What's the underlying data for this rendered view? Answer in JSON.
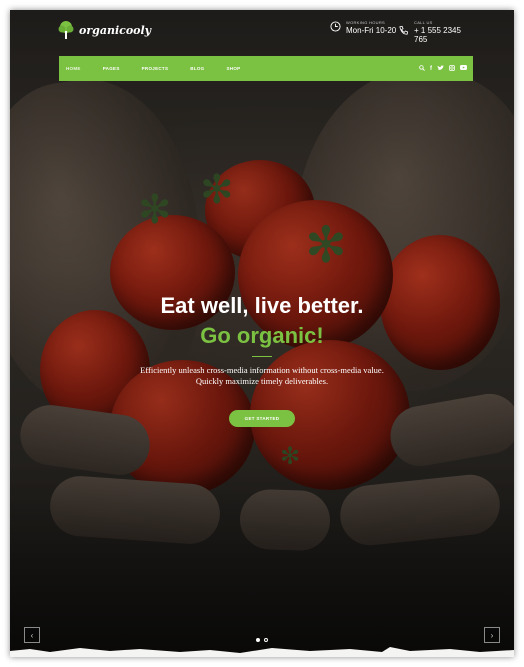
{
  "brand": {
    "name": "organicooly"
  },
  "contact": {
    "hours_label": "WORKING HOURS",
    "hours_value": "Mon-Fri 10-20",
    "phone_label": "CALL US",
    "phone_value": "+ 1 555 2345 765"
  },
  "nav": {
    "items": [
      {
        "label": "HOME"
      },
      {
        "label": "PAGES"
      },
      {
        "label": "PROJECTS"
      },
      {
        "label": "BLOG"
      },
      {
        "label": "SHOP"
      }
    ],
    "active": "HOME"
  },
  "hero": {
    "headline": "Eat well, live better.",
    "headline_accent": "Go organic!",
    "subtitle_line1": "Efficiently unleash cross-media information without cross-media value.",
    "subtitle_line2": "Quickly maximize timely deliverables.",
    "cta_label": "GET STARTED"
  },
  "slider": {
    "slide_count": 2,
    "current": 1
  },
  "icons": {
    "logo": "tree-icon",
    "hours": "clock-icon",
    "phone": "phone-icon",
    "search": "search-icon",
    "facebook": "facebook-icon",
    "twitter": "twitter-icon",
    "instagram": "instagram-icon",
    "youtube": "youtube-icon"
  },
  "colors": {
    "accent": "#7bc142",
    "text": "#ffffff"
  }
}
